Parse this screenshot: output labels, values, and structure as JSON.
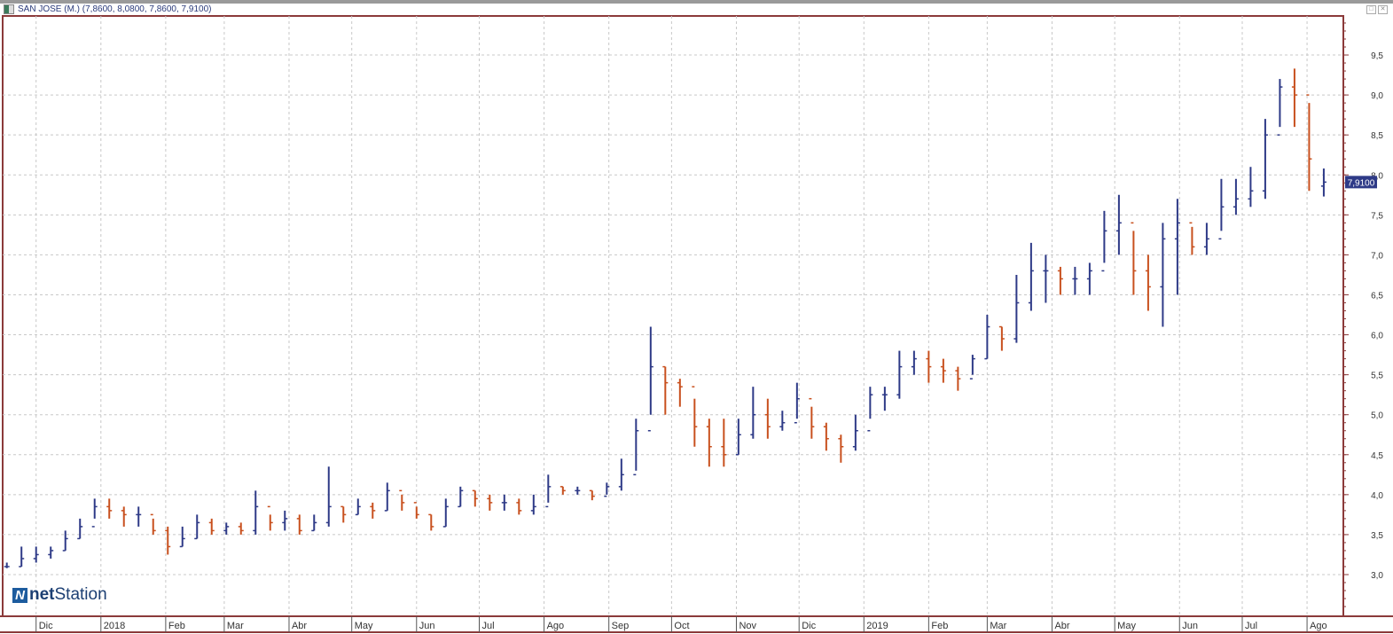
{
  "window": {
    "title": "SAN JOSE (M.) (7,8600, 8,0800, 7,8600, 7,9100)",
    "buttons": [
      "restore",
      "close"
    ]
  },
  "logo": {
    "text_bold": "net",
    "text": "Station"
  },
  "colors": {
    "up": "#2e3a87",
    "down": "#c8501e",
    "frame": "#8b3a3a",
    "grid": "#c8c8c8",
    "last_price_bg": "#2e3a87"
  },
  "chart_data": {
    "type": "ohlc",
    "title": "SAN JOSE (M.)",
    "last_price_label": "7,9100",
    "ylim": [
      2.5,
      10
    ],
    "y_ticks": [
      "3,0",
      "3,5",
      "4,0",
      "4,5",
      "5,0",
      "5,5",
      "6,0",
      "6,5",
      "7,0",
      "7,5",
      "8,0",
      "8,5",
      "9,0",
      "9,5"
    ],
    "y_tick_values": [
      3,
      3.5,
      4,
      4.5,
      5,
      5.5,
      6,
      6.5,
      7,
      7.5,
      8,
      8.5,
      9,
      9.5
    ],
    "x_ticks": [
      "Dic",
      "2018",
      "Feb",
      "Mar",
      "Abr",
      "May",
      "Jun",
      "Jul",
      "Ago",
      "Sep",
      "Oct",
      "Nov",
      "Dic",
      "2019",
      "Feb",
      "Mar",
      "Abr",
      "May",
      "Jun",
      "Jul",
      "Ago"
    ],
    "x_tick_dates": [
      "2017-12-01",
      "2018-01-01",
      "2018-02-01",
      "2018-03-01",
      "2018-04-01",
      "2018-05-01",
      "2018-06-01",
      "2018-07-01",
      "2018-08-01",
      "2018-09-01",
      "2018-10-01",
      "2018-11-01",
      "2018-12-01",
      "2019-01-01",
      "2019-02-01",
      "2019-03-01",
      "2019-04-01",
      "2019-05-01",
      "2019-06-01",
      "2019-07-01",
      "2019-08-01"
    ],
    "grid": true,
    "bars_columns": [
      "date",
      "open",
      "high",
      "low",
      "close"
    ],
    "bars": [
      [
        "2017-11-17",
        3.1,
        3.15,
        3.08,
        3.1
      ],
      [
        "2017-11-24",
        3.1,
        3.35,
        3.1,
        3.2
      ],
      [
        "2017-12-01",
        3.2,
        3.35,
        3.15,
        3.25
      ],
      [
        "2017-12-08",
        3.25,
        3.35,
        3.2,
        3.3
      ],
      [
        "2017-12-15",
        3.3,
        3.55,
        3.3,
        3.45
      ],
      [
        "2017-12-22",
        3.45,
        3.7,
        3.45,
        3.6
      ],
      [
        "2017-12-29",
        3.6,
        3.95,
        3.7,
        3.85
      ],
      [
        "2018-01-05",
        3.85,
        3.95,
        3.7,
        3.8
      ],
      [
        "2018-01-12",
        3.8,
        3.85,
        3.6,
        3.75
      ],
      [
        "2018-01-19",
        3.75,
        3.85,
        3.6,
        3.75
      ],
      [
        "2018-01-26",
        3.75,
        3.7,
        3.5,
        3.55
      ],
      [
        "2018-02-02",
        3.55,
        3.6,
        3.25,
        3.35
      ],
      [
        "2018-02-09",
        3.35,
        3.6,
        3.35,
        3.45
      ],
      [
        "2018-02-16",
        3.45,
        3.75,
        3.45,
        3.65
      ],
      [
        "2018-02-23",
        3.65,
        3.7,
        3.5,
        3.55
      ],
      [
        "2018-03-02",
        3.55,
        3.65,
        3.5,
        3.6
      ],
      [
        "2018-03-09",
        3.6,
        3.65,
        3.5,
        3.55
      ],
      [
        "2018-03-16",
        3.55,
        4.05,
        3.5,
        3.85
      ],
      [
        "2018-03-23",
        3.85,
        3.75,
        3.55,
        3.65
      ],
      [
        "2018-03-30",
        3.65,
        3.8,
        3.55,
        3.7
      ],
      [
        "2018-04-06",
        3.7,
        3.75,
        3.5,
        3.55
      ],
      [
        "2018-04-13",
        3.55,
        3.75,
        3.55,
        3.65
      ],
      [
        "2018-04-20",
        3.65,
        4.35,
        3.6,
        3.85
      ],
      [
        "2018-04-27",
        3.85,
        3.85,
        3.65,
        3.75
      ],
      [
        "2018-05-04",
        3.75,
        3.95,
        3.75,
        3.85
      ],
      [
        "2018-05-11",
        3.85,
        3.9,
        3.7,
        3.8
      ],
      [
        "2018-05-18",
        3.8,
        4.15,
        3.8,
        4.05
      ],
      [
        "2018-05-25",
        4.05,
        4.0,
        3.8,
        3.9
      ],
      [
        "2018-06-01",
        3.9,
        3.85,
        3.7,
        3.75
      ],
      [
        "2018-06-08",
        3.75,
        3.75,
        3.55,
        3.6
      ],
      [
        "2018-06-15",
        3.6,
        3.95,
        3.6,
        3.85
      ],
      [
        "2018-06-22",
        3.85,
        4.1,
        3.85,
        4.05
      ],
      [
        "2018-06-29",
        4.05,
        4.05,
        3.85,
        3.95
      ],
      [
        "2018-07-06",
        3.95,
        4.0,
        3.8,
        3.9
      ],
      [
        "2018-07-13",
        3.9,
        4.0,
        3.8,
        3.9
      ],
      [
        "2018-07-20",
        3.9,
        3.95,
        3.75,
        3.8
      ],
      [
        "2018-07-27",
        3.8,
        4.0,
        3.75,
        3.85
      ],
      [
        "2018-08-03",
        3.85,
        4.25,
        3.9,
        4.1
      ],
      [
        "2018-08-10",
        4.1,
        4.1,
        4.0,
        4.05
      ],
      [
        "2018-08-17",
        4.05,
        4.1,
        4.0,
        4.05
      ],
      [
        "2018-08-24",
        4.05,
        4.05,
        3.93,
        3.98
      ],
      [
        "2018-08-31",
        3.98,
        4.15,
        4.0,
        4.1
      ],
      [
        "2018-09-07",
        4.1,
        4.45,
        4.05,
        4.25
      ],
      [
        "2018-09-14",
        4.25,
        4.95,
        4.3,
        4.8
      ],
      [
        "2018-09-21",
        4.8,
        6.1,
        5.0,
        5.6
      ],
      [
        "2018-09-28",
        5.6,
        5.6,
        5.0,
        5.4
      ],
      [
        "2018-10-05",
        5.4,
        5.45,
        5.1,
        5.35
      ],
      [
        "2018-10-12",
        5.35,
        5.2,
        4.6,
        4.85
      ],
      [
        "2018-10-19",
        4.85,
        4.95,
        4.35,
        4.6
      ],
      [
        "2018-10-26",
        4.6,
        4.95,
        4.35,
        4.5
      ],
      [
        "2018-11-02",
        4.5,
        4.95,
        4.5,
        4.75
      ],
      [
        "2018-11-09",
        4.75,
        5.35,
        4.7,
        5.0
      ],
      [
        "2018-11-16",
        5.0,
        5.2,
        4.7,
        4.85
      ],
      [
        "2018-11-23",
        4.85,
        5.05,
        4.8,
        4.9
      ],
      [
        "2018-11-30",
        4.9,
        5.4,
        4.95,
        5.2
      ],
      [
        "2018-12-07",
        5.2,
        5.1,
        4.7,
        4.85
      ],
      [
        "2018-12-14",
        4.85,
        4.9,
        4.55,
        4.7
      ],
      [
        "2018-12-21",
        4.7,
        4.75,
        4.4,
        4.6
      ],
      [
        "2018-12-28",
        4.6,
        5.0,
        4.55,
        4.8
      ],
      [
        "2019-01-04",
        4.8,
        5.35,
        4.95,
        5.25
      ],
      [
        "2019-01-11",
        5.25,
        5.35,
        5.05,
        5.25
      ],
      [
        "2019-01-18",
        5.25,
        5.8,
        5.2,
        5.6
      ],
      [
        "2019-01-25",
        5.6,
        5.8,
        5.5,
        5.7
      ],
      [
        "2019-02-01",
        5.7,
        5.8,
        5.4,
        5.6
      ],
      [
        "2019-02-08",
        5.6,
        5.7,
        5.4,
        5.55
      ],
      [
        "2019-02-15",
        5.55,
        5.6,
        5.3,
        5.45
      ],
      [
        "2019-02-22",
        5.45,
        5.75,
        5.5,
        5.7
      ],
      [
        "2019-03-01",
        5.7,
        6.25,
        5.7,
        6.1
      ],
      [
        "2019-03-08",
        6.1,
        6.1,
        5.8,
        5.95
      ],
      [
        "2019-03-15",
        5.95,
        6.75,
        5.9,
        6.4
      ],
      [
        "2019-03-22",
        6.4,
        7.15,
        6.3,
        6.8
      ],
      [
        "2019-03-29",
        6.8,
        7.0,
        6.4,
        6.8
      ],
      [
        "2019-04-05",
        6.8,
        6.85,
        6.5,
        6.7
      ],
      [
        "2019-04-12",
        6.7,
        6.85,
        6.5,
        6.7
      ],
      [
        "2019-04-19",
        6.7,
        6.9,
        6.5,
        6.8
      ],
      [
        "2019-04-26",
        6.8,
        7.55,
        6.9,
        7.3
      ],
      [
        "2019-05-03",
        7.3,
        7.75,
        7.0,
        7.4
      ],
      [
        "2019-05-10",
        7.4,
        7.3,
        6.5,
        6.8
      ],
      [
        "2019-05-17",
        6.8,
        7.0,
        6.3,
        6.6
      ],
      [
        "2019-05-24",
        6.6,
        7.4,
        6.1,
        7.2
      ],
      [
        "2019-05-31",
        7.2,
        7.7,
        6.5,
        7.4
      ],
      [
        "2019-06-07",
        7.4,
        7.35,
        7.0,
        7.1
      ],
      [
        "2019-06-14",
        7.1,
        7.4,
        7.0,
        7.2
      ],
      [
        "2019-06-21",
        7.2,
        7.95,
        7.3,
        7.6
      ],
      [
        "2019-06-28",
        7.6,
        7.95,
        7.5,
        7.7
      ],
      [
        "2019-07-05",
        7.7,
        8.1,
        7.6,
        7.8
      ],
      [
        "2019-07-12",
        7.8,
        8.7,
        7.7,
        8.5
      ],
      [
        "2019-07-19",
        8.5,
        9.2,
        8.6,
        9.1
      ],
      [
        "2019-07-26",
        9.1,
        9.33,
        8.6,
        9.0
      ],
      [
        "2019-08-02",
        9.0,
        8.9,
        7.8,
        8.2
      ],
      [
        "2019-08-09",
        7.86,
        8.08,
        7.73,
        7.91
      ]
    ]
  }
}
